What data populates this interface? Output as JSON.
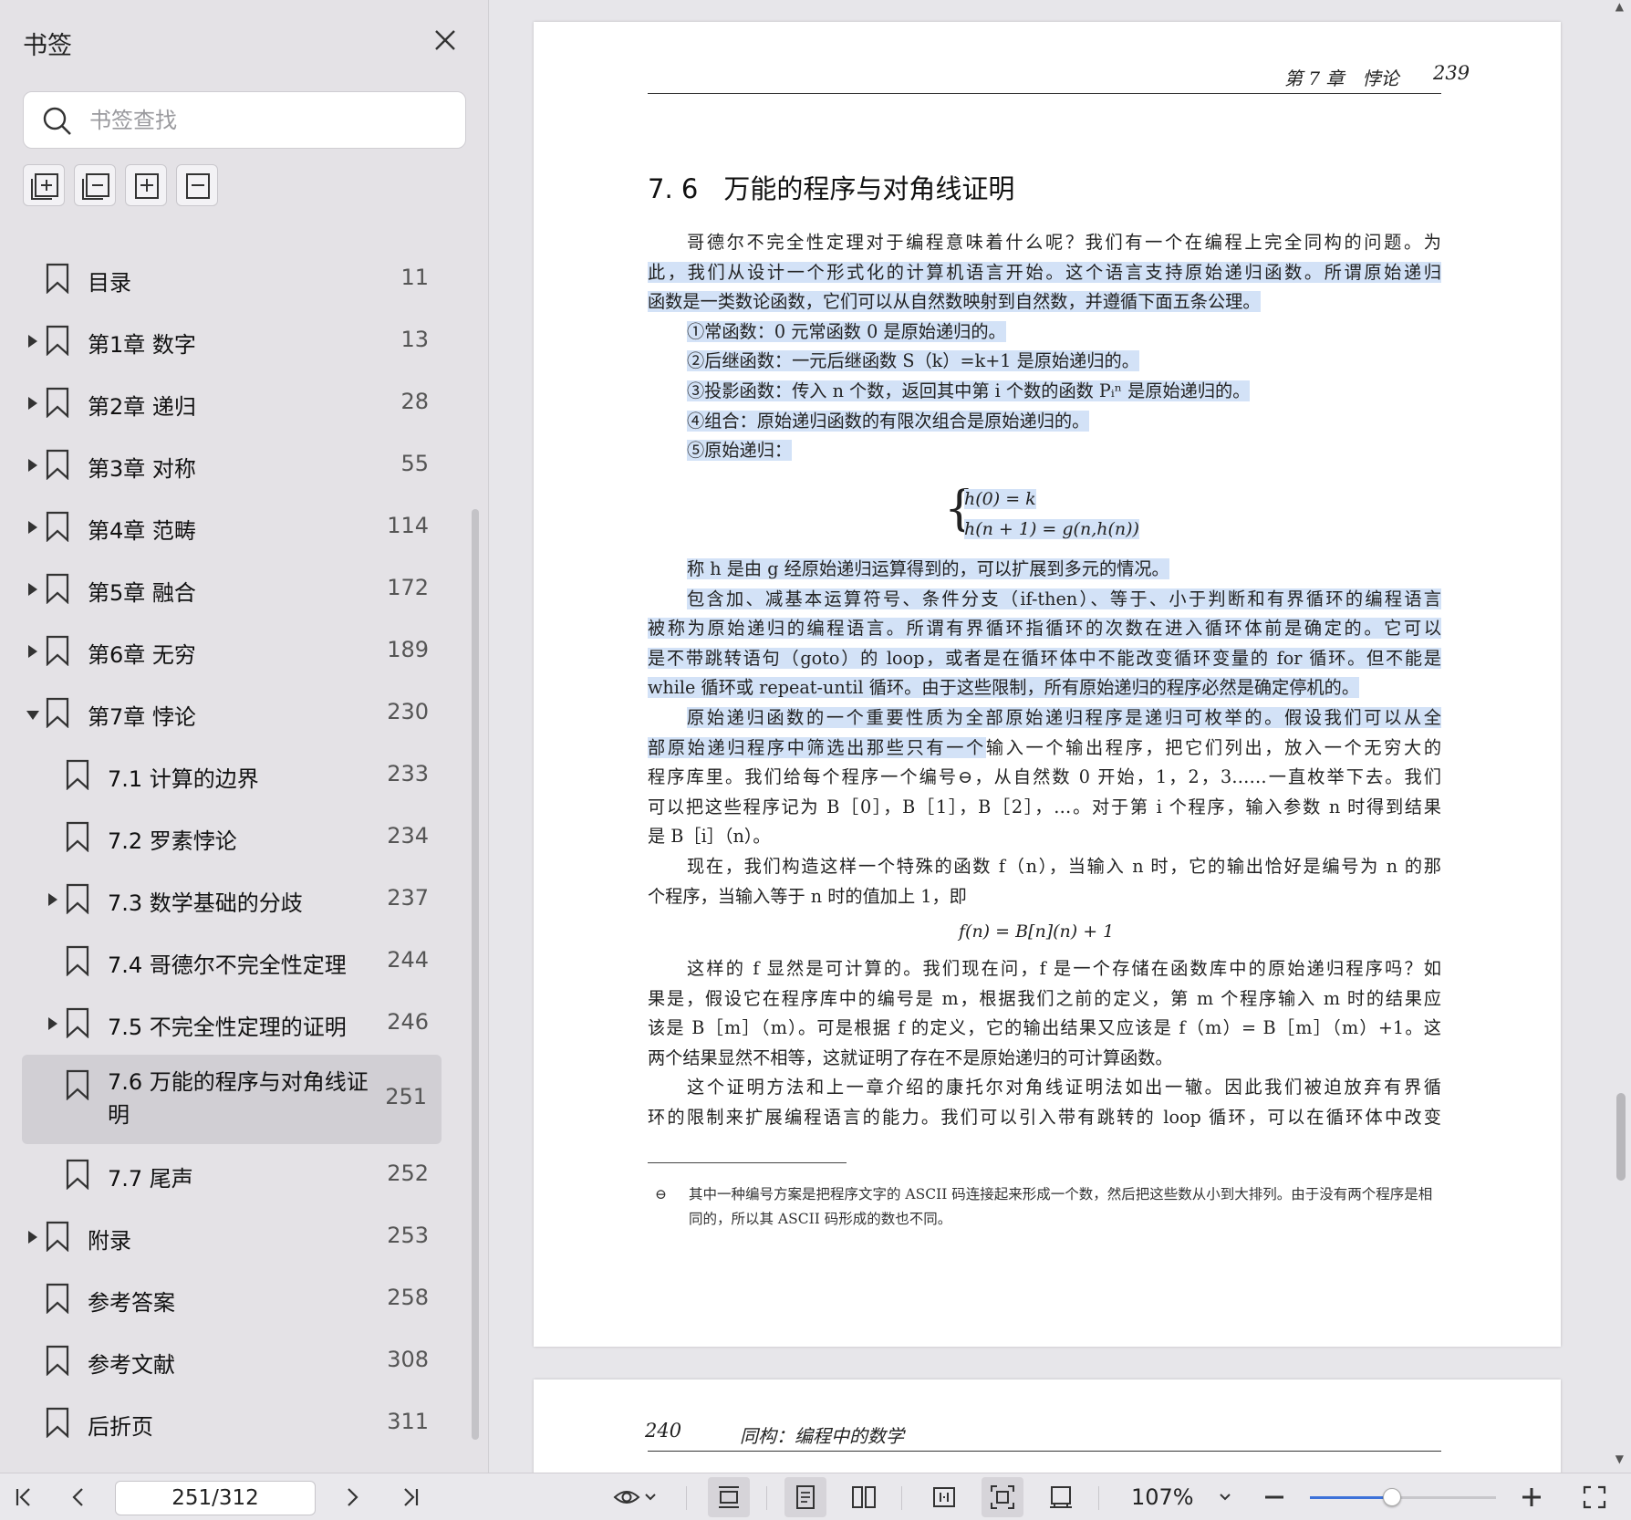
{
  "sidebar": {
    "title": "书签",
    "search_placeholder": "书签查找",
    "items": [
      {
        "label": "目录",
        "page": "11",
        "level": 0,
        "arrow": "none"
      },
      {
        "label": "第1章 数字",
        "page": "13",
        "level": 0,
        "arrow": "right"
      },
      {
        "label": "第2章 递归",
        "page": "28",
        "level": 0,
        "arrow": "right"
      },
      {
        "label": "第3章 对称",
        "page": "55",
        "level": 0,
        "arrow": "right"
      },
      {
        "label": "第4章 范畴",
        "page": "114",
        "level": 0,
        "arrow": "right"
      },
      {
        "label": "第5章 融合",
        "page": "172",
        "level": 0,
        "arrow": "right"
      },
      {
        "label": "第6章 无穷",
        "page": "189",
        "level": 0,
        "arrow": "right"
      },
      {
        "label": "第7章 悖论",
        "page": "230",
        "level": 0,
        "arrow": "down"
      },
      {
        "label": "7.1 计算的边界",
        "page": "233",
        "level": 1,
        "arrow": "none"
      },
      {
        "label": "7.2 罗素悖论",
        "page": "234",
        "level": 1,
        "arrow": "none"
      },
      {
        "label": "7.3 数学基础的分歧",
        "page": "237",
        "level": 1,
        "arrow": "right"
      },
      {
        "label": "7.4 哥德尔不完全性定理",
        "page": "244",
        "level": 1,
        "arrow": "none"
      },
      {
        "label": "7.5 不完全性定理的证明",
        "page": "246",
        "level": 1,
        "arrow": "right"
      },
      {
        "label": "7.6 万能的程序与对角线证明",
        "page": "251",
        "level": 1,
        "arrow": "none",
        "active": true
      },
      {
        "label": "7.7 尾声",
        "page": "252",
        "level": 1,
        "arrow": "none"
      },
      {
        "label": "附录",
        "page": "253",
        "level": 0,
        "arrow": "right"
      },
      {
        "label": "参考答案",
        "page": "258",
        "level": 0,
        "arrow": "none"
      },
      {
        "label": "参考文献",
        "page": "308",
        "level": 0,
        "arrow": "none"
      },
      {
        "label": "后折页",
        "page": "311",
        "level": 0,
        "arrow": "none"
      }
    ]
  },
  "doc": {
    "p239": {
      "header_chapter": "第 7 章　悖论",
      "header_page": "239",
      "section_num": "7. 6",
      "section_title": "万能的程序与对角线证明",
      "lines_a": [
        {
          "t": "哥德尔不完全性定理对于编程意味着什么呢？我们有一个在编程上完全同构的问题。为",
          "ind": true,
          "hl": false
        },
        {
          "t": "此，我们从设计一个形式化的计算机语言开始。这个语言支持原始递归函数。所谓原始递归",
          "ind": false,
          "hl": true
        },
        {
          "t": "函数是一类数论函数，它们可以从自然数映射到自然数，并遵循下面五条公理。",
          "ind": false,
          "hl": true,
          "last": true
        },
        {
          "t": "①常函数：0 元常函数 0 是原始递归的。",
          "ind": true,
          "hl": true,
          "last": true
        },
        {
          "t": "②后继函数：一元后继函数 S（k）=k+1 是原始递归的。",
          "ind": true,
          "hl": true,
          "last": true
        },
        {
          "t": "③投影函数：传入 n 个数，返回其中第 i 个数的函数 Pᵢⁿ 是原始递归的。",
          "ind": true,
          "hl": true,
          "last": true
        },
        {
          "t": "④组合：原始递归函数的有限次组合是原始递归的。",
          "ind": true,
          "hl": true,
          "last": true
        },
        {
          "t": "⑤原始递归：",
          "ind": true,
          "hl": true,
          "last": true
        }
      ],
      "formula_1a": "h(0) = k",
      "formula_1b": "h(n + 1) = g(n,h(n))",
      "lines_b": [
        {
          "t": "称 h 是由 g 经原始递归运算得到的，可以扩展到多元的情况。",
          "ind": true,
          "hl": true,
          "last": true
        },
        {
          "t": "包含加、减基本运算符号、条件分支（if-then）、等于、小于判断和有界循环的编程语言",
          "ind": true,
          "hl": true
        },
        {
          "t": "被称为原始递归的编程语言。所谓有界循环指循环的次数在进入循环体前是确定的。它可以",
          "ind": false,
          "hl": true
        },
        {
          "t": "是不带跳转语句（goto）的 loop，或者是在循环体中不能改变循环变量的 for 循环。但不能是",
          "ind": false,
          "hl": true
        },
        {
          "t": "while 循环或 repeat-until 循环。由于这些限制，所有原始递归的程序必然是确定停机的。",
          "ind": false,
          "hl": true,
          "last": true
        },
        {
          "t": "原始递归函数的一个重要性质为全部原始递归程序是递归可枚举的。假设我们可以从全",
          "ind": true,
          "hl": true
        },
        {
          "t": "部原始递归程序中筛选出那些只有一个输入一个输出程序，把它们列出，放入一个无穷大的",
          "ind": false,
          "hl": "partial",
          "split": 17
        },
        {
          "t": "程序库里。我们给每个程序一个编号⊖，从自然数 0 开始，1，2，3……一直枚举下去。我们",
          "ind": false,
          "hl": false
        },
        {
          "t": "可以把这些程序记为 B［0］，B［1］，B［2］，…。对于第 i 个程序，输入参数 n 时得到结果",
          "ind": false,
          "hl": false
        },
        {
          "t": "是 B［i］（n）。",
          "ind": false,
          "hl": false,
          "last": true
        },
        {
          "t": "现在，我们构造这样一个特殊的函数 f（n），当输入 n 时，它的输出恰好是编号为 n 的那",
          "ind": true,
          "hl": false
        },
        {
          "t": "个程序，当输入等于 n 时的值加上 1，即",
          "ind": false,
          "hl": false,
          "last": true
        }
      ],
      "formula_2": "f(n) = B[n](n) + 1",
      "lines_c": [
        {
          "t": "这样的 f 显然是可计算的。我们现在问，f 是一个存储在函数库中的原始递归程序吗？如",
          "ind": true,
          "hl": false
        },
        {
          "t": "果是，假设它在程序库中的编号是 m，根据我们之前的定义，第 m 个程序输入 m 时的结果应",
          "ind": false,
          "hl": false
        },
        {
          "t": "该是 B［m］（m）。可是根据 f 的定义，它的输出结果又应该是 f（m）= B［m］（m）+1。这",
          "ind": false,
          "hl": false
        },
        {
          "t": "两个结果显然不相等，这就证明了存在不是原始递归的可计算函数。",
          "ind": false,
          "hl": false,
          "last": true
        },
        {
          "t": "这个证明方法和上一章介绍的康托尔对角线证明法如出一辙。因此我们被迫放弃有界循",
          "ind": true,
          "hl": false
        },
        {
          "t": "环的限制来扩展编程语言的能力。我们可以引入带有跳转的 loop 循环，可以在循环体中改变",
          "ind": false,
          "hl": false
        }
      ],
      "footnote_mark": "⊖",
      "footnote": "其中一种编号方案是把程序文字的 ASCII 码连接起来形成一个数，然后把这些数从小到大排列。由于没有两个程序是相同的，所以其 ASCII 码形成的数也不同。"
    },
    "p240": {
      "header_page": "240",
      "header_title": "同构：编程中的数学"
    }
  },
  "toolbar": {
    "page_value": "251/312",
    "zoom": "107%",
    "zoom_fraction": 0.44
  },
  "colors": {
    "highlight": "#d3e2f7",
    "accent": "#3d72d9",
    "sidebar_bg": "#e4e2e6",
    "active_item": "#d1cfd4"
  }
}
